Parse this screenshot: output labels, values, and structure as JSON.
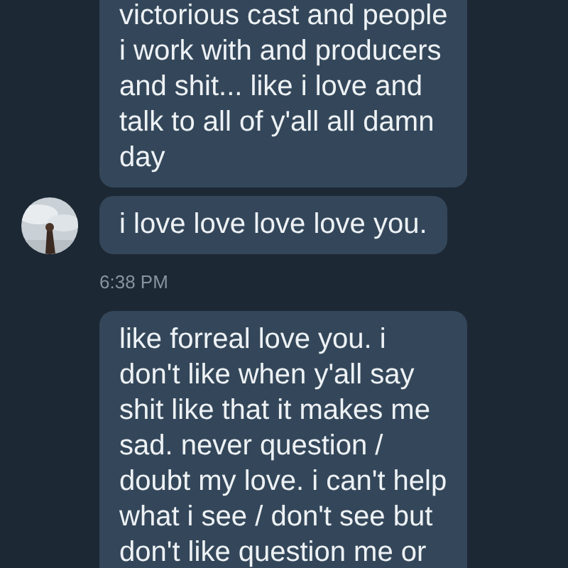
{
  "conversation": [
    {
      "kind": "message",
      "show_avatar": false,
      "text": "victorious cast and people\ni work with and producers\nand shit... like i love and\ntalk to all of y'all all damn\nday"
    },
    {
      "kind": "message",
      "show_avatar": true,
      "text": "i love love love love you."
    },
    {
      "kind": "timestamp",
      "text": "6:38 PM"
    },
    {
      "kind": "message",
      "show_avatar": false,
      "text": "like forreal love you. i\ndon't like when y'all say\nshit like that it makes me\nsad. never question /\ndoubt my love. i can't help\nwhat i see / don't see but\ndon't like question me or"
    }
  ]
}
